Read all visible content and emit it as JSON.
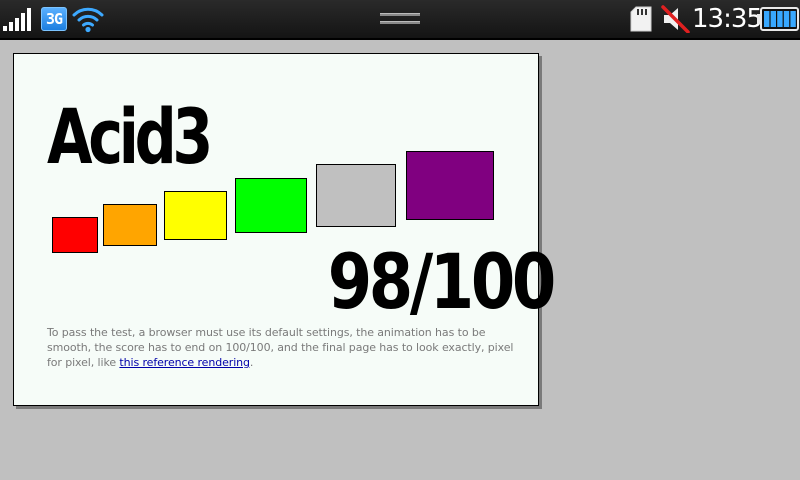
{
  "status_bar": {
    "network_badge": "3G",
    "time": "13:35",
    "signal_bars": 5,
    "battery_level": 1.0,
    "icons": [
      "signal-icon",
      "3g-icon",
      "wifi-icon",
      "notification-handle-icon",
      "sd-card-icon",
      "mute-icon",
      "battery-icon"
    ]
  },
  "page": {
    "title": "Acid3",
    "score": "98/100",
    "buckets": [
      {
        "color": "#ff0000"
      },
      {
        "color": "#ffa500"
      },
      {
        "color": "#ffff00"
      },
      {
        "color": "#00ff00"
      },
      {
        "color": "#c0c0c0"
      },
      {
        "color": "#800080"
      }
    ],
    "description_before": "To pass the test, a browser must use its default settings, the animation has to be smooth, the score has to end on 100/100, and the final page has to look exactly, pixel for pixel, like ",
    "description_link": "this reference rendering",
    "description_after": "."
  },
  "colors": {
    "background": "#c0c0c0",
    "page": "#f6fcf8",
    "status_bar": "#1a1a1a",
    "badge_3g": "#2b8cf0",
    "link": "#0000aa",
    "text_muted": "#7a7a7a"
  }
}
